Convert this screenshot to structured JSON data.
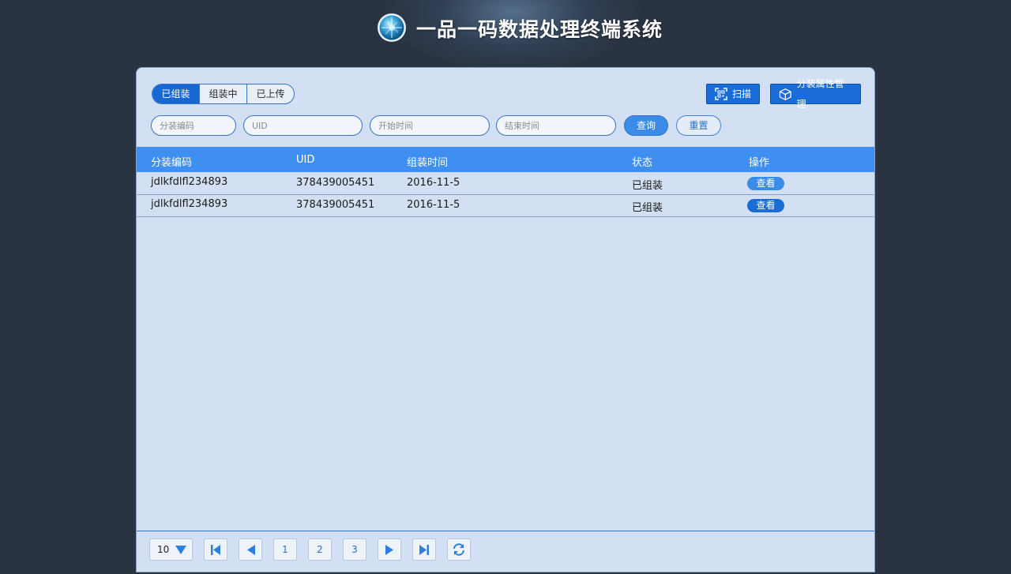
{
  "app": {
    "title": "一品一码数据处理终端系统"
  },
  "tabs": [
    {
      "label": "已组装",
      "active": true
    },
    {
      "label": "组装中",
      "active": false
    },
    {
      "label": "已上传",
      "active": false
    }
  ],
  "actions": {
    "scan_label": "扫描",
    "attr_label": "分装属性管理"
  },
  "filters": {
    "code_placeholder": "分装编码",
    "uid_placeholder": "UID",
    "start_placeholder": "开始时间",
    "end_placeholder": "结束时间",
    "query_label": "查询",
    "reset_label": "重置"
  },
  "table": {
    "columns": [
      "分装编码",
      "UID",
      "组装时间",
      "状态",
      "操作"
    ],
    "rows": [
      {
        "code": "jdlkfdlfl234893",
        "uid": "378439005451",
        "time": "2016-11-5",
        "status": "已组装",
        "action": "查看"
      },
      {
        "code": "jdlkfdlfl234893",
        "uid": "378439005451",
        "time": "2016-11-5",
        "status": "已组装",
        "action": "查看"
      }
    ]
  },
  "pagination": {
    "page_size": "10",
    "pages": [
      "1",
      "2",
      "3"
    ]
  },
  "colors": {
    "background": "#2a3342",
    "panel": "#d3e0f3",
    "header": "#3e8ff0",
    "primary": "#1a6cd6"
  }
}
